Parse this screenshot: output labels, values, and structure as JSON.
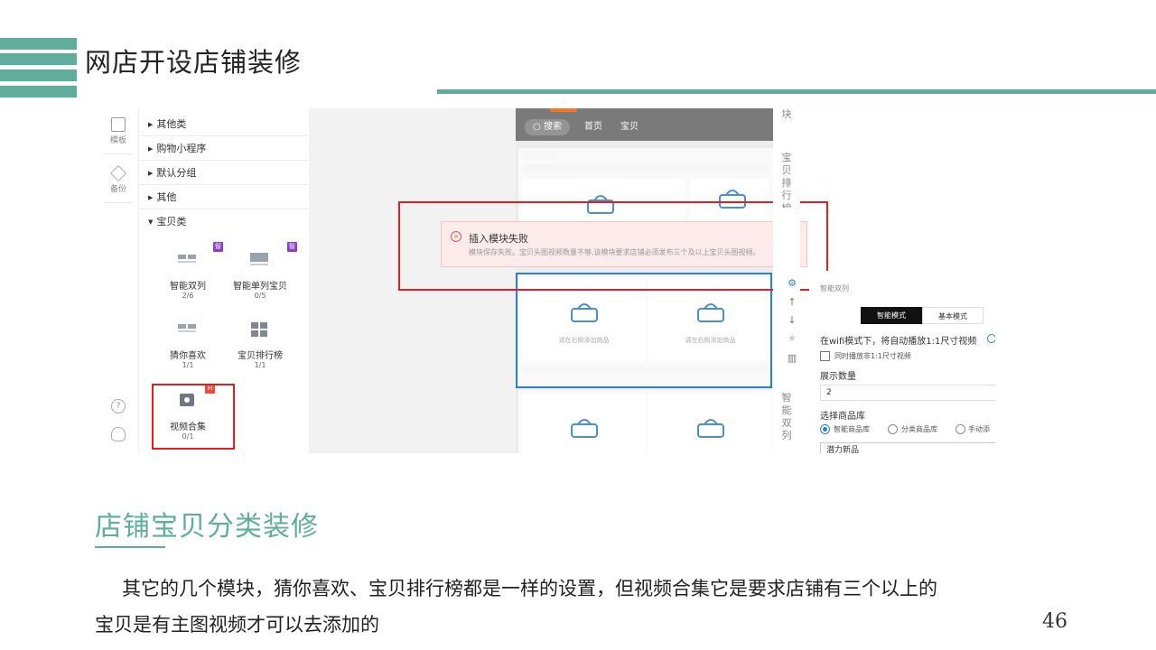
{
  "slide": {
    "title": "网店开设店铺装修",
    "section_title": "店铺宝贝分类装修",
    "paragraph_line1": "其它的几个模块，猜你喜欢、宝贝排行榜都是一样的设置，但视频合集它是要求店铺有三个以上的",
    "paragraph_line2": "宝贝是有主图视频才可以去添加的",
    "page_number": "46",
    "accent_color": "#5fae9c"
  },
  "editor": {
    "rail": {
      "template_label": "模板",
      "backup_label": "备份",
      "help_icon": "question-icon",
      "service_icon": "headset-icon"
    },
    "categories": [
      {
        "label": "其他类"
      },
      {
        "label": "购物小程序"
      },
      {
        "label": "默认分组"
      },
      {
        "label": "其他"
      },
      {
        "label": "宝贝类"
      }
    ],
    "modules": [
      {
        "name": "智能双列",
        "count": "2/6",
        "badge": "智"
      },
      {
        "name": "智能单列宝贝",
        "count": "0/5",
        "badge": "智"
      },
      {
        "name": "猜你喜欢",
        "count": "1/1"
      },
      {
        "name": "宝贝排行榜",
        "count": "1/1"
      },
      {
        "name": "视频合集",
        "count": "0/1",
        "badge": "H"
      }
    ],
    "preview": {
      "search_label": "搜索",
      "nav_home": "首页",
      "nav_items": "宝贝",
      "empty_hint": "请在右侧添加商品"
    },
    "toast": {
      "title": "插入模块失败",
      "message": "模块保存失败。宝贝头图视频数量不够,该模块要求店铺必须发布三个及以上宝贝头图视频。"
    },
    "side_labels": {
      "top": "块",
      "ranking": "宝贝排行榜",
      "double": "智能双列"
    },
    "settings": {
      "module_name": "智能双列",
      "mode_smart": "智能模式",
      "mode_basic": "基本模式",
      "wifi_text": "在wifi模式下，将自动播放1:1尺寸视频",
      "sync_text": "同时播放非1:1尺寸视频",
      "count_label": "展示数量",
      "count_value": "2",
      "library_label": "选择商品库",
      "lib_smart": "智能商品库",
      "lib_category": "分类商品库",
      "lib_manual": "手动添",
      "library_value": "潜力新品"
    }
  }
}
